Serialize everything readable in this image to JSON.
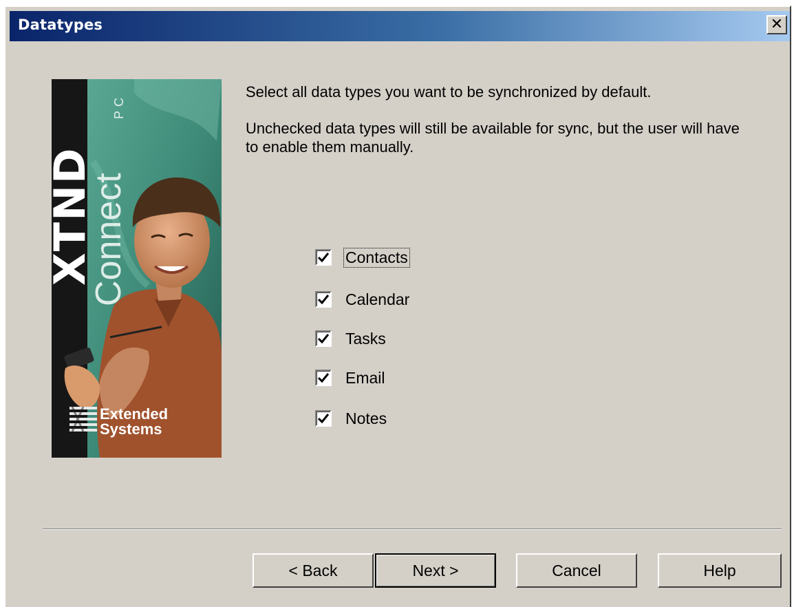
{
  "window": {
    "title": "Datatypes",
    "close_label": "✕"
  },
  "branding": {
    "product_main": "XTND",
    "product_sub": "Connect",
    "product_suffix": "PC",
    "company_line1": "Extended",
    "company_line2": "Systems",
    "colors": {
      "teal": "#3e8a78",
      "teal_dark": "#225b4f",
      "shirt": "#a0522d",
      "skin": "#d99a6c",
      "hair": "#4a2f1a"
    }
  },
  "instructions": {
    "line1": "Select all data types you want to be synchronized by default.",
    "line2": "Unchecked data types will still be available for sync, but the user will have to enable them manually."
  },
  "datatypes": [
    {
      "label": "Contacts",
      "checked": true,
      "focused": true
    },
    {
      "label": "Calendar",
      "checked": true,
      "focused": false
    },
    {
      "label": "Tasks",
      "checked": true,
      "focused": false
    },
    {
      "label": "Email",
      "checked": true,
      "focused": false
    },
    {
      "label": "Notes",
      "checked": true,
      "focused": false
    }
  ],
  "buttons": {
    "back": "< Back",
    "next": "Next >",
    "cancel": "Cancel",
    "help": "Help"
  }
}
